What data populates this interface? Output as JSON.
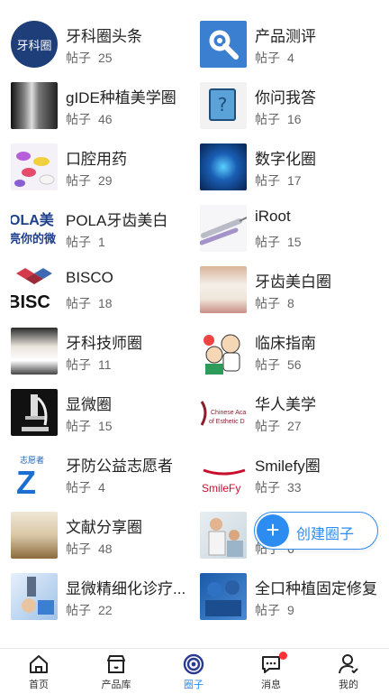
{
  "post_label": "帖子",
  "circles": [
    {
      "name": "牙科圈头条",
      "count": "25",
      "icon": "logo-icon",
      "logo_text": "牙科圈"
    },
    {
      "name": "产品测评",
      "count": "4",
      "icon": "gear-icon"
    },
    {
      "name": "gIDE种植美学圈",
      "count": "46",
      "icon": "xray-image"
    },
    {
      "name": "你问我答",
      "count": "16",
      "icon": "question-book-icon"
    },
    {
      "name": "口腔用药",
      "count": "29",
      "icon": "pills-image"
    },
    {
      "name": "数字化圈",
      "count": "17",
      "icon": "digital-image"
    },
    {
      "name": "POLA牙齿美白",
      "count": "1",
      "icon": "pola-logo",
      "logo_text": "OLA美 亮你的微"
    },
    {
      "name": "iRoot",
      "count": "15",
      "icon": "syringe-image"
    },
    {
      "name": "BISCO",
      "count": "18",
      "icon": "bisco-logo",
      "logo_text": "BISCO"
    },
    {
      "name": "牙齿美白圈",
      "count": "8",
      "icon": "teeth-image"
    },
    {
      "name": "牙科技师圈",
      "count": "11",
      "icon": "dental-model-image"
    },
    {
      "name": "临床指南",
      "count": "56",
      "icon": "cartoon-doctor-image"
    },
    {
      "name": "显微圈",
      "count": "15",
      "icon": "microscope-image"
    },
    {
      "name": "华人美学",
      "count": "27",
      "icon": "chinese-academy-logo",
      "logo_text": "Chinese Aca of Esthetic D"
    },
    {
      "name": "牙防公益志愿者",
      "count": "4",
      "icon": "volunteer-logo",
      "logo_text": "志愿者"
    },
    {
      "name": "Smilefy圈",
      "count": "33",
      "icon": "smilefy-logo",
      "logo_text": "SmileFy"
    },
    {
      "name": "文献分享圈",
      "count": "48",
      "icon": "book-image"
    },
    {
      "name": "",
      "count": "6",
      "icon": "clinic-people-image"
    },
    {
      "name": "显微精细化诊疗...",
      "count": "22",
      "icon": "micro-clinic-image"
    },
    {
      "name": "全口种植固定修复",
      "count": "9",
      "icon": "surgery-image"
    }
  ],
  "create_button": {
    "label": "创建圈子",
    "plus": "+"
  },
  "tabs": [
    {
      "label": "首页",
      "icon": "home-icon"
    },
    {
      "label": "产品库",
      "icon": "store-icon"
    },
    {
      "label": "圈子",
      "icon": "circle-target-icon",
      "active": true
    },
    {
      "label": "消息",
      "icon": "message-icon",
      "badge": true
    },
    {
      "label": "我的",
      "icon": "profile-icon"
    }
  ],
  "colors": {
    "accent": "#2d8cf0",
    "badge": "#ff3333",
    "text": "#222222",
    "muted": "#666666"
  }
}
